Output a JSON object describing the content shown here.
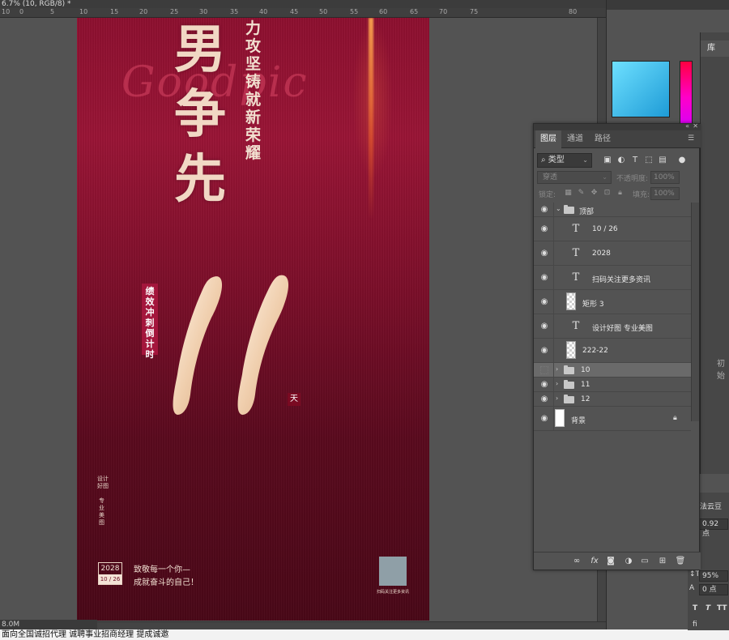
{
  "document": {
    "title": "6.7% (10, RGB/8) *",
    "ruler_ticks": [
      "10",
      "0",
      "5",
      "10",
      "15",
      "20",
      "25",
      "30",
      "35",
      "40",
      "45",
      "50",
      "55",
      "60",
      "65",
      "70",
      "75",
      "80"
    ]
  },
  "poster": {
    "watermark": "Goodpic",
    "calligraphy": "男争先",
    "slogan": "力攻坚铸就新荣耀",
    "badge_vertical": "绩效冲刺倒计时",
    "big_number": "11",
    "day_label": "天",
    "signature_1": "设计好图",
    "signature_2": "专业美图",
    "date_year": "2028",
    "date_md": "10 / 26",
    "tagline_1": "致敬每一个你—",
    "tagline_2": "成就奋斗的自己！",
    "qr_label": "扫码关注更多资讯"
  },
  "status": {
    "zoom": "6.7%",
    "doc_info": "8.0M",
    "taskbar_text": "面向全国诚招代理 诚聘事业招商经理 提成诚邀"
  },
  "dock": {
    "library_tab": "库",
    "library_status": "初始",
    "char_font": "书法云豆",
    "char_size": "0.92 点",
    "char_scale": "95%",
    "char_tracking": "0 点",
    "char_extra": "%",
    "char_sym_1": "T",
    "char_sym_2": "T",
    "char_sym_3": "TT",
    "char_sym_4": "fi"
  },
  "layers": {
    "tabs": [
      "图层",
      "通道",
      "路径"
    ],
    "kind_filter": "类型",
    "blend_mode": "穿透",
    "opacity_label": "不透明度:",
    "opacity_value": "100%",
    "lock_label": "锁定:",
    "fill_label": "填充:",
    "fill_value": "100%",
    "items": [
      {
        "name": "顶部",
        "kind": "group-open"
      },
      {
        "name": "10 / 26",
        "kind": "text"
      },
      {
        "name": "2028",
        "kind": "text"
      },
      {
        "name": "扫码关注更多资讯",
        "kind": "text"
      },
      {
        "name": "矩形 3",
        "kind": "shape"
      },
      {
        "name": "设计好图 专业美图",
        "kind": "text"
      },
      {
        "name": "222-22",
        "kind": "smart"
      },
      {
        "name": "10",
        "kind": "group",
        "visible": false,
        "selected": true
      },
      {
        "name": "11",
        "kind": "group"
      },
      {
        "name": "12",
        "kind": "group"
      },
      {
        "name": "背景",
        "kind": "background",
        "locked": true
      }
    ]
  },
  "icons": {
    "eye": "eye-icon",
    "text_layer": "T",
    "folder": "folder-icon",
    "lock": "lock-icon"
  },
  "colors": {
    "poster_red": "#8e1030",
    "gold": "#f1d8c4",
    "panel_bg": "#535353",
    "accent_cyan": "#4cc7f2"
  }
}
